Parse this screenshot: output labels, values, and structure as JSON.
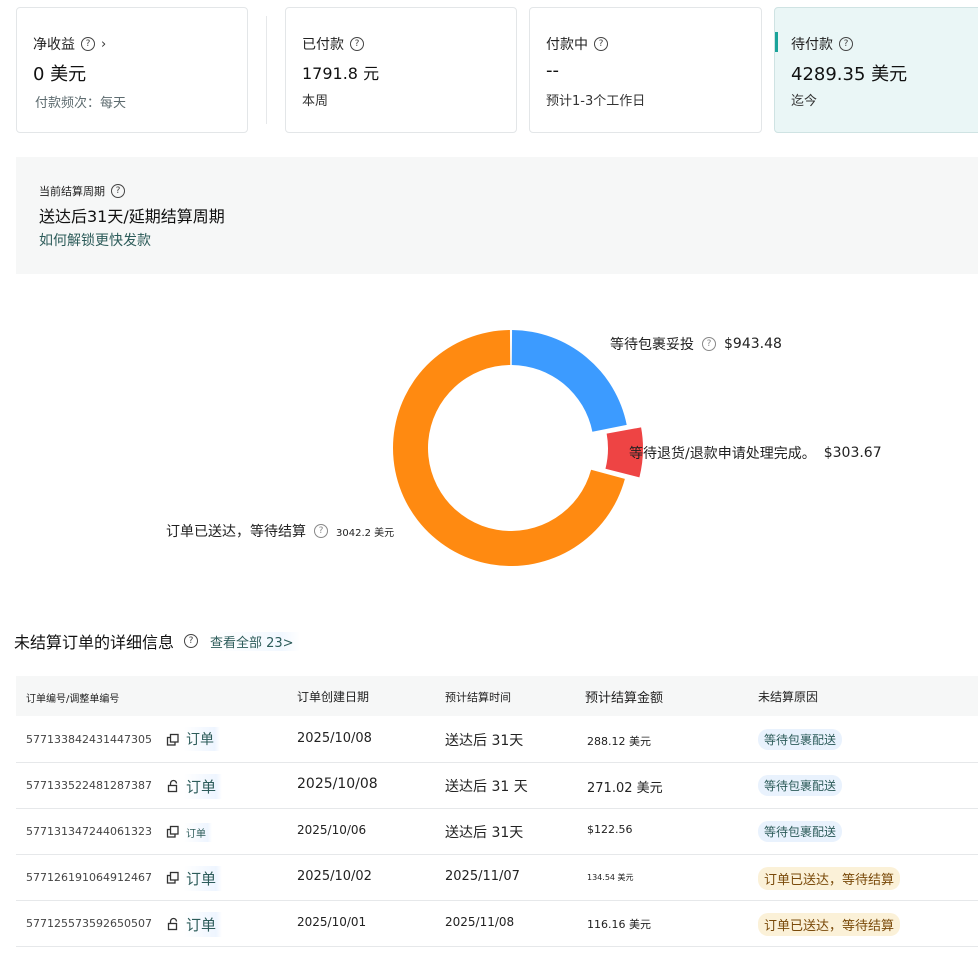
{
  "summary_cards": [
    {
      "label": "净收益",
      "value": "0 美元",
      "sub": "付款频次：每天",
      "has_chevron": true
    },
    {
      "label": "已付款",
      "value": "1791.8 元",
      "sub": "本周"
    },
    {
      "label": "付款中",
      "value": "--",
      "sub": "预计1-3个工作日"
    },
    {
      "label": "待付款",
      "value": "4289.35 美元",
      "sub": "迄今",
      "active": true
    }
  ],
  "cycle": {
    "label": "当前结算周期",
    "value": "送达后31天/延期结算周期",
    "link": "如何解锁更快发款"
  },
  "colors": {
    "blue": "#3c9bff",
    "red": "#ee4444",
    "orange": "#ff8a11",
    "accent": "#1aa39a"
  },
  "chart_data": {
    "type": "pie",
    "slices": [
      {
        "label": "等待包裹妥投",
        "value": 943.48,
        "display": "$943.48",
        "color": "#3c9bff"
      },
      {
        "label": "等待退货/退款申请处理完成。",
        "value": 303.67,
        "display": "$303.67",
        "color": "#ee4444"
      },
      {
        "label": "订单已送达，等待结算",
        "value": 3042.2,
        "display": "3042.2 美元",
        "color": "#ff8a11"
      }
    ]
  },
  "details": {
    "title": "未结算订单的详细信息",
    "view_all": "查看全部 23>",
    "columns": [
      "订单编号/调整单编号",
      "订单创建日期",
      "预计结算时间",
      "预计结算金额",
      "未结算原因"
    ],
    "rows": [
      {
        "id": "577133842431447305",
        "link": "订单",
        "date": "2025/10/08",
        "settle": "送达后 31天",
        "amount": "288.12 美元",
        "reason": "等待包裹配送",
        "reason_color": "blue"
      },
      {
        "id": "577133522481287387",
        "link": "订单",
        "date": "2025/10/08",
        "settle": "送达后 31 天",
        "amount": "271.02 美元",
        "reason": "等待包裹配送",
        "reason_color": "blue"
      },
      {
        "id": "577131347244061323",
        "link": "订单",
        "date": "2025/10/06",
        "settle": "送达后 31天",
        "amount": "$122.56",
        "reason": "等待包裹配送",
        "reason_color": "blue"
      },
      {
        "id": "577126191064912467",
        "link": "订单",
        "date": "2025/10/02",
        "settle": "2025/11/07",
        "amount": "134.54 美元",
        "reason": "订单已送达，等待结算",
        "reason_color": "yellow"
      },
      {
        "id": "577125573592650507",
        "link": "订单",
        "date": "2025/10/01",
        "settle": "2025/11/08",
        "amount": "116.16 美元",
        "reason": "订单已送达，等待结算",
        "reason_color": "yellow"
      }
    ]
  }
}
